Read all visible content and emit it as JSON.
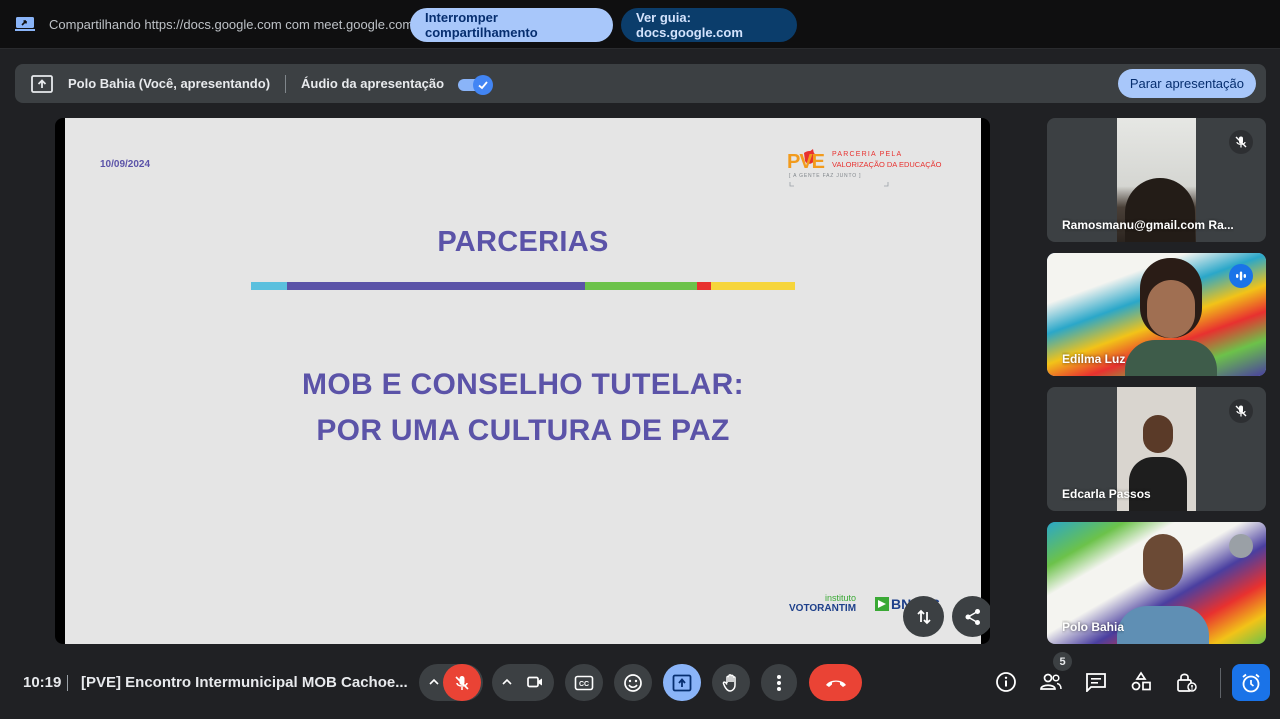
{
  "sharebar": {
    "status_text": "Compartilhando https://docs.google.com com meet.google.com",
    "stop_sharing_label": "Interromper compartilhamento",
    "view_guide_label": "Ver guia: docs.google.com"
  },
  "presentation_bar": {
    "presenter": "Polo Bahia (Você, apresentando)",
    "audio_label": "Áudio da apresentação",
    "audio_enabled": true,
    "stop_presentation_label": "Parar apresentação"
  },
  "slide": {
    "date": "10/09/2024",
    "logo_title": "PVE",
    "logo_line1": "PARCERIA PELA",
    "logo_line2": "VALORIZAÇÃO DA EDUCAÇÃO",
    "logo_tagline": "[ A GENTE FAZ JUNTO ]",
    "heading": "PARCERIAS",
    "title_line1": "MOB E CONSELHO TUTELAR:",
    "title_line2": "POR UMA CULTURA DE PAZ",
    "partner1_top": "instituto",
    "partner1_name": "VOTORANTIM",
    "partner2_name": "BNDES",
    "accent_color": "#5b53a8"
  },
  "participants": [
    {
      "name": "Ramosmanu@gmail.com Ra...",
      "muted": true
    },
    {
      "name": "Edilma Luz",
      "speaking": true
    },
    {
      "name": "Edcarla Passos",
      "muted": true
    },
    {
      "name": "Polo Bahia",
      "muted": false
    }
  ],
  "toolbar": {
    "time": "10:19",
    "meeting_title": "[PVE] Encontro Intermunicipal MOB Cachoe...",
    "people_count": "5"
  }
}
